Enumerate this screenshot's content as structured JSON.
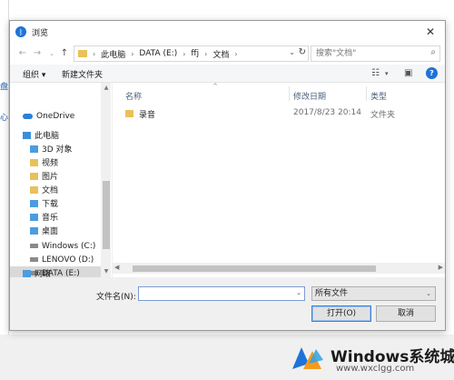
{
  "dialog": {
    "title": "浏览",
    "close_symbol": "✕"
  },
  "address": {
    "path": [
      "此电脑",
      "DATA (E:)",
      "ffj",
      "文档"
    ],
    "search_placeholder": "搜索\"文档\""
  },
  "toolbar": {
    "organize_label": "组织 ▾",
    "new_folder_label": "新建文件夹"
  },
  "sidebar": {
    "items": [
      {
        "label": "OneDrive",
        "icon": "onedrive-icon"
      },
      {
        "label": "此电脑",
        "icon": "computer-icon"
      },
      {
        "label": "3D 对象",
        "icon": "folder-3d-icon"
      },
      {
        "label": "视频",
        "icon": "video-folder-icon"
      },
      {
        "label": "图片",
        "icon": "pictures-folder-icon"
      },
      {
        "label": "文档",
        "icon": "documents-folder-icon"
      },
      {
        "label": "下载",
        "icon": "downloads-folder-icon"
      },
      {
        "label": "音乐",
        "icon": "music-folder-icon"
      },
      {
        "label": "桌面",
        "icon": "desktop-folder-icon"
      },
      {
        "label": "Windows (C:)",
        "icon": "drive-icon"
      },
      {
        "label": "LENOVO (D:)",
        "icon": "drive-icon"
      },
      {
        "label": "DATA (E:)",
        "icon": "drive-icon",
        "selected": true
      },
      {
        "label": "网络",
        "icon": "network-icon"
      }
    ]
  },
  "file_list": {
    "columns": [
      "名称",
      "修改日期",
      "类型"
    ],
    "rows": [
      {
        "name": "录音",
        "modified": "2017/8/23 20:14",
        "type": "文件夹"
      }
    ]
  },
  "footer": {
    "filename_label": "文件名(N):",
    "filename_value": "",
    "filetype_value": "所有文件",
    "open_label": "打开(O)",
    "cancel_label": "取消"
  },
  "background": {
    "edge_letters": [
      "盘",
      "心"
    ]
  },
  "watermark": {
    "title": "Windows系统城",
    "url": "www.wxclgg.com"
  },
  "colors": {
    "accent": "#1e73d8",
    "folder": "#e8c15a",
    "selection": "#d9d9d9"
  }
}
